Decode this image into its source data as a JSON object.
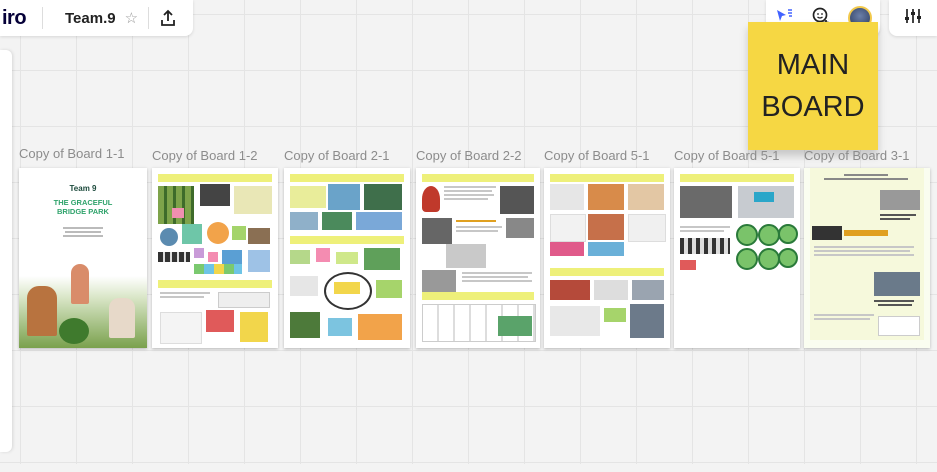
{
  "app": {
    "logo_text": "iro",
    "board_title": "Team.9"
  },
  "icons": {
    "star": "star-icon",
    "upload": "upload-icon",
    "reactions": "cursor-reactions-icon",
    "add_collaborator": "add-timer-icon",
    "settings": "sliders-icon"
  },
  "sticky": {
    "line1": "MAIN",
    "line2": "BOARD",
    "color": "#f6d743"
  },
  "boards": [
    {
      "label": "Copy of Board 1-1"
    },
    {
      "label": "Copy of Board 1-2"
    },
    {
      "label": "Copy of Board 2-1"
    },
    {
      "label": "Copy of Board 2-2"
    },
    {
      "label": "Copy of Board 5-1"
    },
    {
      "label": "Copy of Board 5-1"
    },
    {
      "label": "Copy of Board 3-1"
    }
  ],
  "cover": {
    "team": "Team 9",
    "title_line1": "THE GRACEFUL",
    "title_line2": "BRIDGE PARK"
  },
  "colors": {
    "accent_blue": "#4262ff",
    "sticky_yellow": "#f6d743",
    "header_green": "#eef07a"
  }
}
